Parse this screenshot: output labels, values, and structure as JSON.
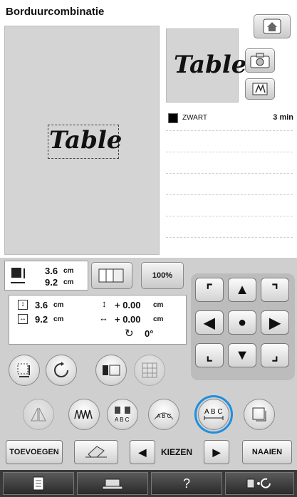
{
  "header": {
    "title": "Borduurcombinatie"
  },
  "preview": {
    "text": "Table"
  },
  "thread_list": {
    "items": [
      {
        "color_name": "ZWART",
        "time": "3 min",
        "swatch": "#000000"
      }
    ]
  },
  "size_info": {
    "width": "3.6",
    "height": "9.2",
    "unit": "cm",
    "zoom": "100%"
  },
  "position_info": {
    "height": "3.6",
    "width": "9.2",
    "unit": "cm",
    "v_offset": "+ 0.00",
    "h_offset": "+ 0.00",
    "rotation": "0°"
  },
  "bottom_row": {
    "add_label": "TOEVOEGEN",
    "select_label": "KIEZEN",
    "sew_label": "NAAIEN"
  },
  "accent": "#1e8fe0",
  "icons": [
    "home-icon",
    "camera-icon",
    "thread-spool-icon",
    "pattern-size-icon",
    "rotate-icon",
    "array-icon",
    "density-icon",
    "mirror-icon",
    "spacing-icon",
    "arc-icon",
    "text-spacing-icon",
    "border-icon",
    "eraser-icon",
    "page-icon",
    "machine-icon",
    "question-icon",
    "settings-icon"
  ],
  "tabs": {
    "help": "?"
  }
}
